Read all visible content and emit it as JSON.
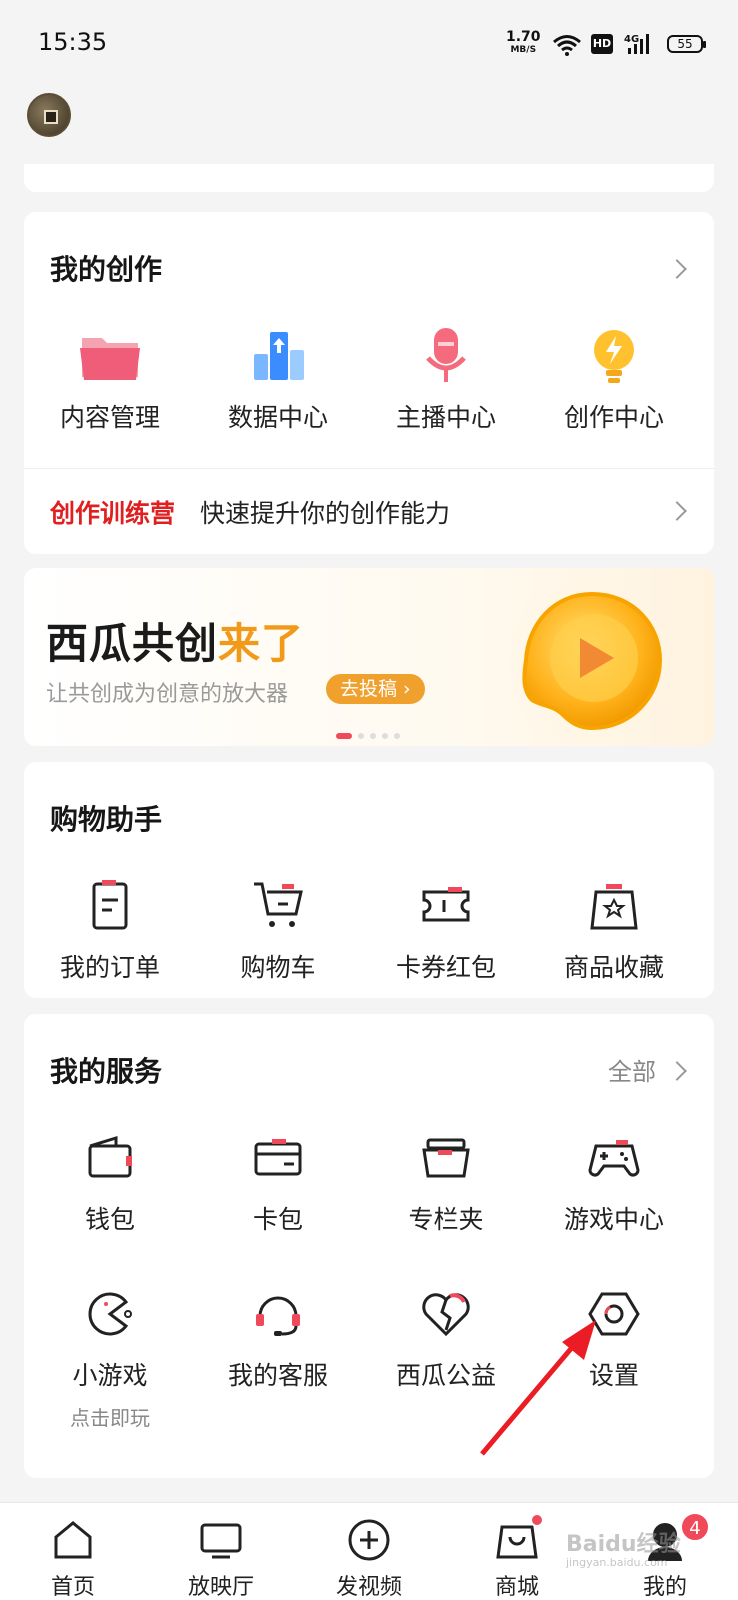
{
  "status_bar": {
    "time": "15:35",
    "net_speed_value": "1.70",
    "net_speed_unit": "MB/S",
    "hd": "HD",
    "network": "4G",
    "battery": "55"
  },
  "my_creation": {
    "title": "我的创作",
    "items": [
      {
        "label": "内容管理",
        "icon": "folder-icon"
      },
      {
        "label": "数据中心",
        "icon": "data-chart-icon"
      },
      {
        "label": "主播中心",
        "icon": "microphone-icon"
      },
      {
        "label": "创作中心",
        "icon": "lightbulb-icon"
      }
    ],
    "training_tag": "创作训练营",
    "training_text": "快速提升你的创作能力"
  },
  "banner": {
    "title_main": "西瓜共创",
    "title_highlight": "来了",
    "subtitle": "让共创成为创意的放大器",
    "button": "去投稿"
  },
  "shopping": {
    "title": "购物助手",
    "items": [
      {
        "label": "我的订单",
        "icon": "order-icon"
      },
      {
        "label": "购物车",
        "icon": "cart-icon"
      },
      {
        "label": "卡券红包",
        "icon": "coupon-icon"
      },
      {
        "label": "商品收藏",
        "icon": "favorite-bag-icon"
      }
    ]
  },
  "services": {
    "title": "我的服务",
    "all_label": "全部",
    "row1": [
      {
        "label": "钱包",
        "icon": "wallet-icon"
      },
      {
        "label": "卡包",
        "icon": "card-icon"
      },
      {
        "label": "专栏夹",
        "icon": "column-folder-icon"
      },
      {
        "label": "游戏中心",
        "icon": "gamepad-icon"
      }
    ],
    "row2": [
      {
        "label": "小游戏",
        "sub": "点击即玩",
        "icon": "pacman-icon"
      },
      {
        "label": "我的客服",
        "icon": "headset-icon"
      },
      {
        "label": "西瓜公益",
        "icon": "heart-icon"
      },
      {
        "label": "设置",
        "icon": "settings-icon"
      }
    ]
  },
  "bottom_nav": {
    "items": [
      {
        "label": "首页",
        "icon": "home-icon"
      },
      {
        "label": "放映厅",
        "icon": "tv-icon"
      },
      {
        "label": "发视频",
        "icon": "plus-circle-icon"
      },
      {
        "label": "商城",
        "icon": "shopping-bag-icon"
      },
      {
        "label": "我的",
        "icon": "profile-icon"
      }
    ],
    "badge": "4"
  },
  "watermark": {
    "text": "Baidu经验",
    "url": "jingyan.baidu.com"
  },
  "colors": {
    "accent_red": "#f04a5a",
    "training_red": "#e02020",
    "banner_orange": "#f19a1a"
  }
}
